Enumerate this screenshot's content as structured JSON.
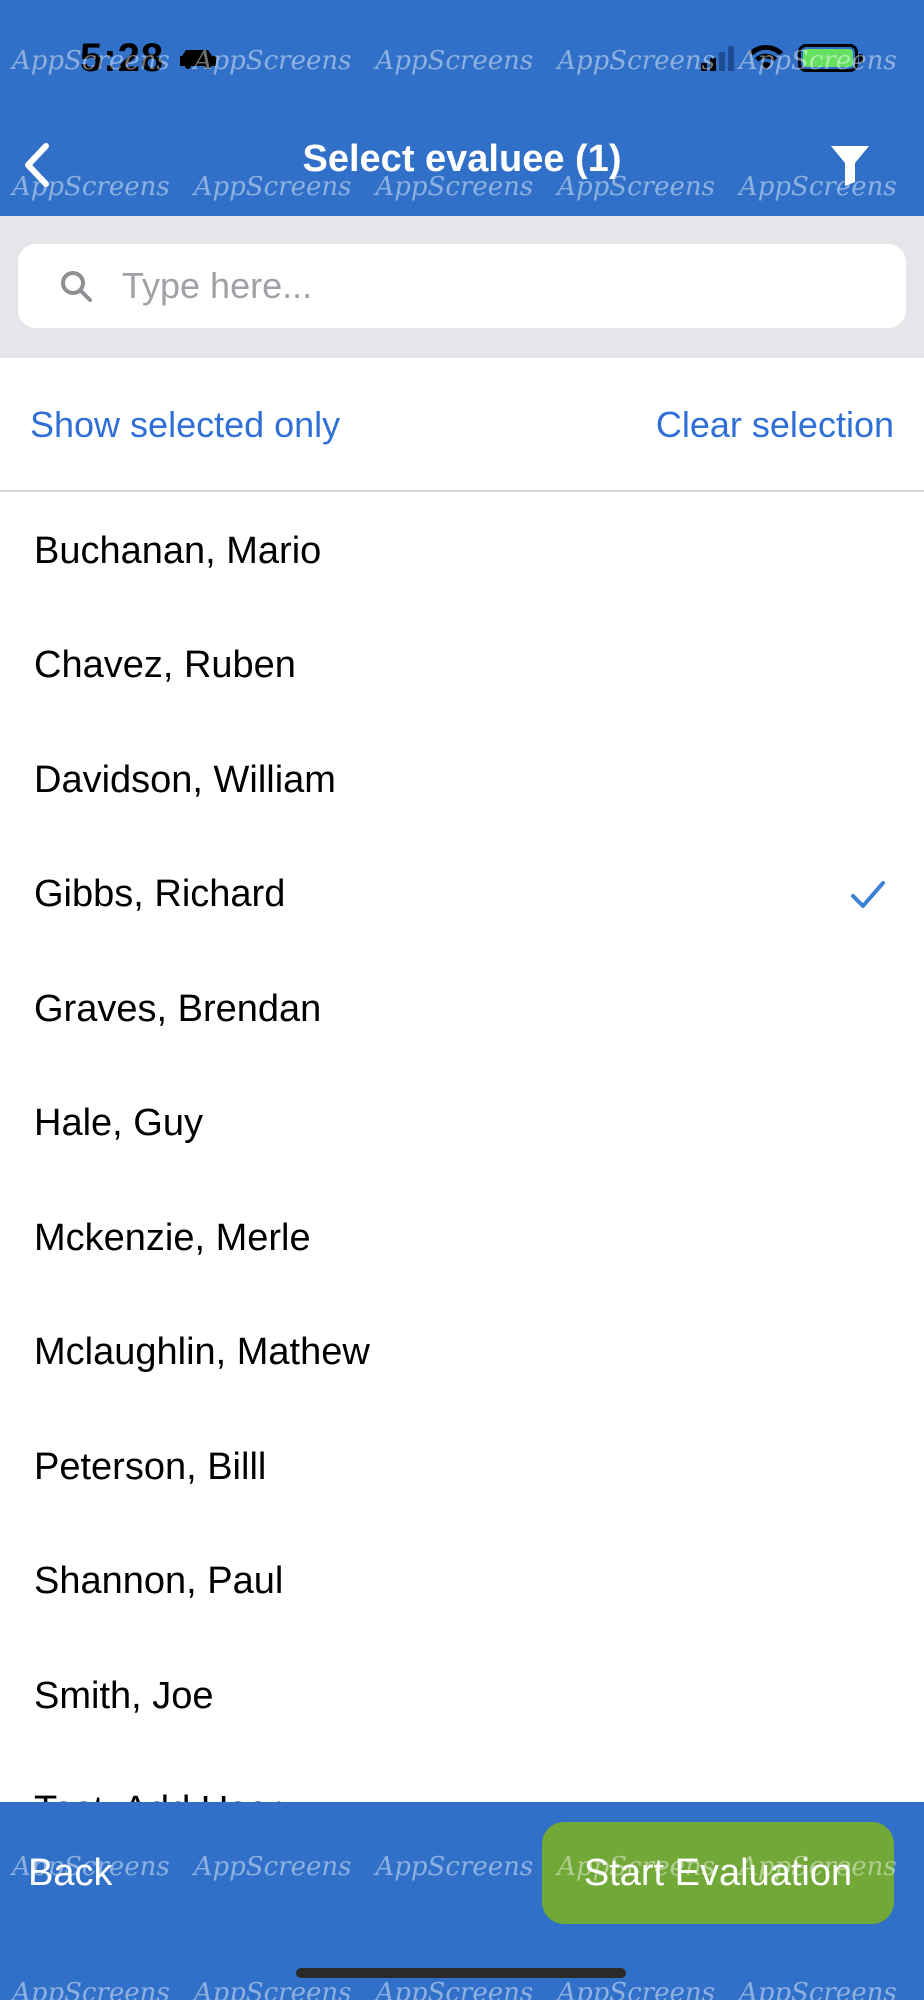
{
  "status_bar": {
    "time": "5:28"
  },
  "header": {
    "title": "Select evaluee (1)"
  },
  "watermark": {
    "text": "AppScreens"
  },
  "search": {
    "placeholder": "Type here..."
  },
  "actions": {
    "show_selected": "Show selected only",
    "clear_selection": "Clear selection"
  },
  "list": {
    "items": [
      {
        "name": "Buchanan, Mario",
        "selected": false
      },
      {
        "name": "Chavez, Ruben",
        "selected": false
      },
      {
        "name": "Davidson, William",
        "selected": false
      },
      {
        "name": "Gibbs, Richard",
        "selected": true
      },
      {
        "name": "Graves, Brendan",
        "selected": false
      },
      {
        "name": "Hale, Guy",
        "selected": false
      },
      {
        "name": "Mckenzie, Merle",
        "selected": false
      },
      {
        "name": "Mclaughlin, Mathew",
        "selected": false
      },
      {
        "name": "Peterson, Billl",
        "selected": false
      },
      {
        "name": "Shannon, Paul",
        "selected": false
      },
      {
        "name": "Smith, Joe",
        "selected": false
      },
      {
        "name": "Test, Add User",
        "selected": false
      }
    ]
  },
  "bottom_bar": {
    "back_label": "Back",
    "start_label": "Start Evaluation"
  },
  "colors": {
    "primary": "#3070c8",
    "link": "#2f6fd6",
    "start": "#72a838",
    "check": "#3a82d6"
  },
  "icons": {
    "back": "chevron-left-icon",
    "filter": "filter-icon",
    "search": "search-icon",
    "check": "checkmark-icon"
  }
}
